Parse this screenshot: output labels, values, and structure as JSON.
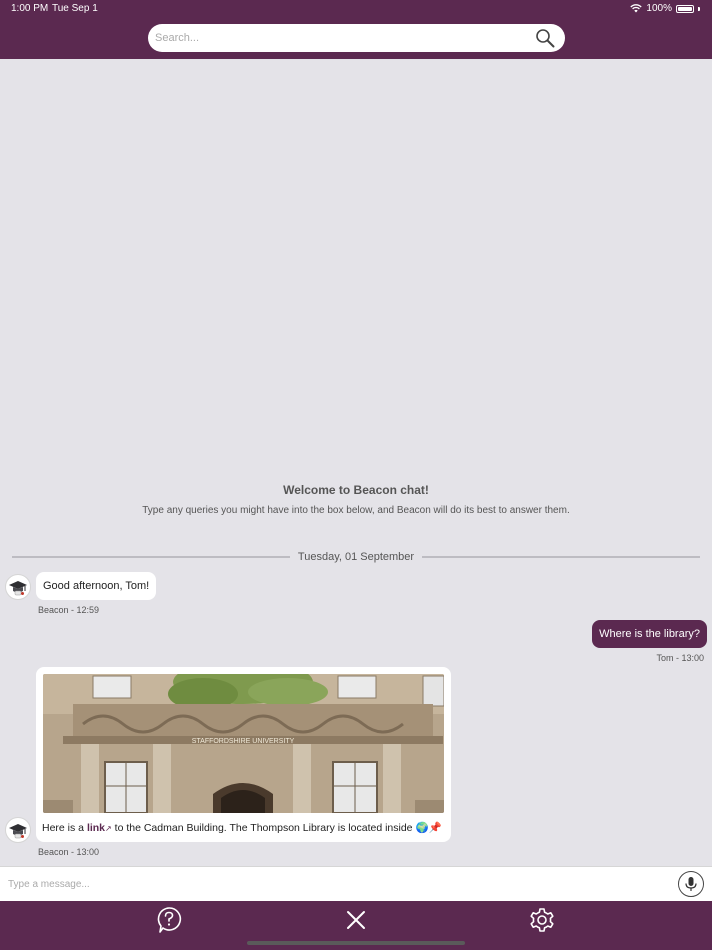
{
  "status_bar": {
    "time": "1:00 PM",
    "date": "Tue Sep 1",
    "battery": "100%",
    "battery_level": 1.0
  },
  "search": {
    "placeholder": "Search..."
  },
  "welcome": {
    "title": "Welcome to Beacon chat!",
    "text": "Type any queries you might have into the box below, and Beacon will do its best to answer them."
  },
  "date_divider": "Tuesday, 01 September",
  "messages": [
    {
      "sender": "bot",
      "text": "Good afternoon, Tom!",
      "meta": "Beacon - 12:59"
    },
    {
      "sender": "user",
      "text": "Where is the library?",
      "meta": "Tom - 13:00"
    },
    {
      "sender": "bot",
      "text_before": "Here is a",
      "link_text": "link",
      "text_after": "to the Cadman Building. The Thompson Library is located inside",
      "emoji": "🌍📌",
      "image_sign": "STAFFORDSHIRE UNIVERSITY",
      "meta": "Beacon - 13:00"
    }
  ],
  "composer": {
    "placeholder": "Type a message..."
  },
  "icons": {
    "search": "search-icon",
    "mic": "microphone-icon",
    "help": "help-bubble-icon",
    "close": "close-icon",
    "settings": "gear-icon",
    "avatar": "graduation-cap-icon",
    "external_link": "external-link-icon"
  },
  "colors": {
    "brand": "#5b2950",
    "background": "#e4e3e8"
  }
}
